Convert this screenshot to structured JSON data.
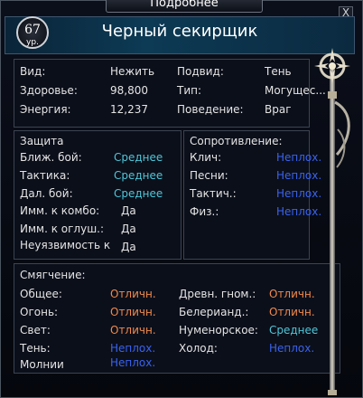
{
  "window": {
    "title": "Подробнее",
    "close": "X"
  },
  "header": {
    "name": "Черный секирщик",
    "level": "67",
    "level_label": "ур."
  },
  "info": {
    "kind_label": "Вид:",
    "kind_value": "Нежить",
    "subkind_label": "Подвид:",
    "subkind_value": "Тень",
    "health_label": "Здоровье:",
    "health_value": "98,800",
    "type_label": "Тип:",
    "type_value": "Могущес...",
    "energy_label": "Энергия:",
    "energy_value": "12,237",
    "behavior_label": "Поведение:",
    "behavior_value": "Враг"
  },
  "defense": {
    "title": "Защита",
    "rows": [
      {
        "label": "Ближ. бой:",
        "value": "Среднее"
      },
      {
        "label": "Тактика:",
        "value": "Среднее"
      },
      {
        "label": "Дал. бой:",
        "value": "Среднее"
      },
      {
        "label": "Имм. к комбо:",
        "value": "Да"
      },
      {
        "label": "Имм. к оглуш.:",
        "value": "Да"
      },
      {
        "label": "Неуязвимость к",
        "value": "Да"
      }
    ]
  },
  "resistance": {
    "title": "Сопротивление:",
    "rows": [
      {
        "label": "Клич:",
        "value": "Неплох."
      },
      {
        "label": "Песни:",
        "value": "Неплох."
      },
      {
        "label": "Тактич.:",
        "value": "Неплох."
      },
      {
        "label": "Физ.:",
        "value": "Неплох."
      }
    ]
  },
  "mitigation": {
    "title": "Смягчение:",
    "left": [
      {
        "label": "Общее:",
        "value": "Отличн."
      },
      {
        "label": "Огонь:",
        "value": "Отличн."
      },
      {
        "label": "Свет:",
        "value": "Отличн."
      },
      {
        "label": "Тень:",
        "value": "Неплох."
      },
      {
        "label": "Молнии",
        "value": "Неплох."
      }
    ],
    "right": [
      {
        "label": "Древн. гном.:",
        "value": "Отличн."
      },
      {
        "label": "Белерианд.:",
        "value": "Отличн."
      },
      {
        "label": "Нуменорское:",
        "value": "Среднее"
      },
      {
        "label": "Холод:",
        "value": "Неплох."
      }
    ]
  },
  "colors": {
    "good": "#f08a4b",
    "average": "#4fc6d8",
    "weak": "#3a62ee"
  }
}
